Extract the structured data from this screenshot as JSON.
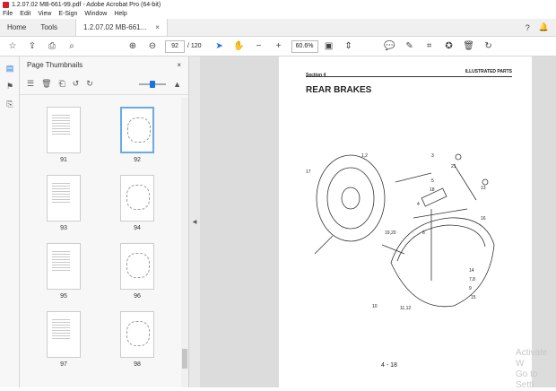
{
  "window": {
    "title": "1.2.07.02  MB-661-99.pdf - Adobe Acrobat Pro (64-bit)"
  },
  "menu": [
    "File",
    "Edit",
    "View",
    "E-Sign",
    "Window",
    "Help"
  ],
  "tabs": {
    "home": "Home",
    "tools": "Tools",
    "doc": "1.2.07.02  MB-661...",
    "close": "×"
  },
  "toolbar": {
    "page_value": "92",
    "page_total": "/  120",
    "zoom": "60.6%"
  },
  "thumb_pane": {
    "title": "Page Thumbnails",
    "close": "×",
    "thumbs": [
      {
        "label": "91",
        "kind": "text"
      },
      {
        "label": "92",
        "kind": "drawing",
        "selected": true
      },
      {
        "label": "93",
        "kind": "text"
      },
      {
        "label": "94",
        "kind": "drawing"
      },
      {
        "label": "95",
        "kind": "text"
      },
      {
        "label": "96",
        "kind": "drawing"
      },
      {
        "label": "97",
        "kind": "text"
      },
      {
        "label": "98",
        "kind": "drawing"
      }
    ]
  },
  "page": {
    "section": "Section 4",
    "header_right": "ILLUSTRATED PARTS",
    "title": "REAR BRAKES",
    "page_number": "4 - 18",
    "callouts": [
      "1,2",
      "17",
      "3",
      "21",
      "5",
      "13",
      "18",
      "4",
      "16",
      "19,20",
      "6",
      "7,8",
      "14",
      "9",
      "10",
      "11,12",
      "15"
    ]
  },
  "watermark": {
    "line1": "Activate W",
    "line2": "Go to Setti"
  }
}
